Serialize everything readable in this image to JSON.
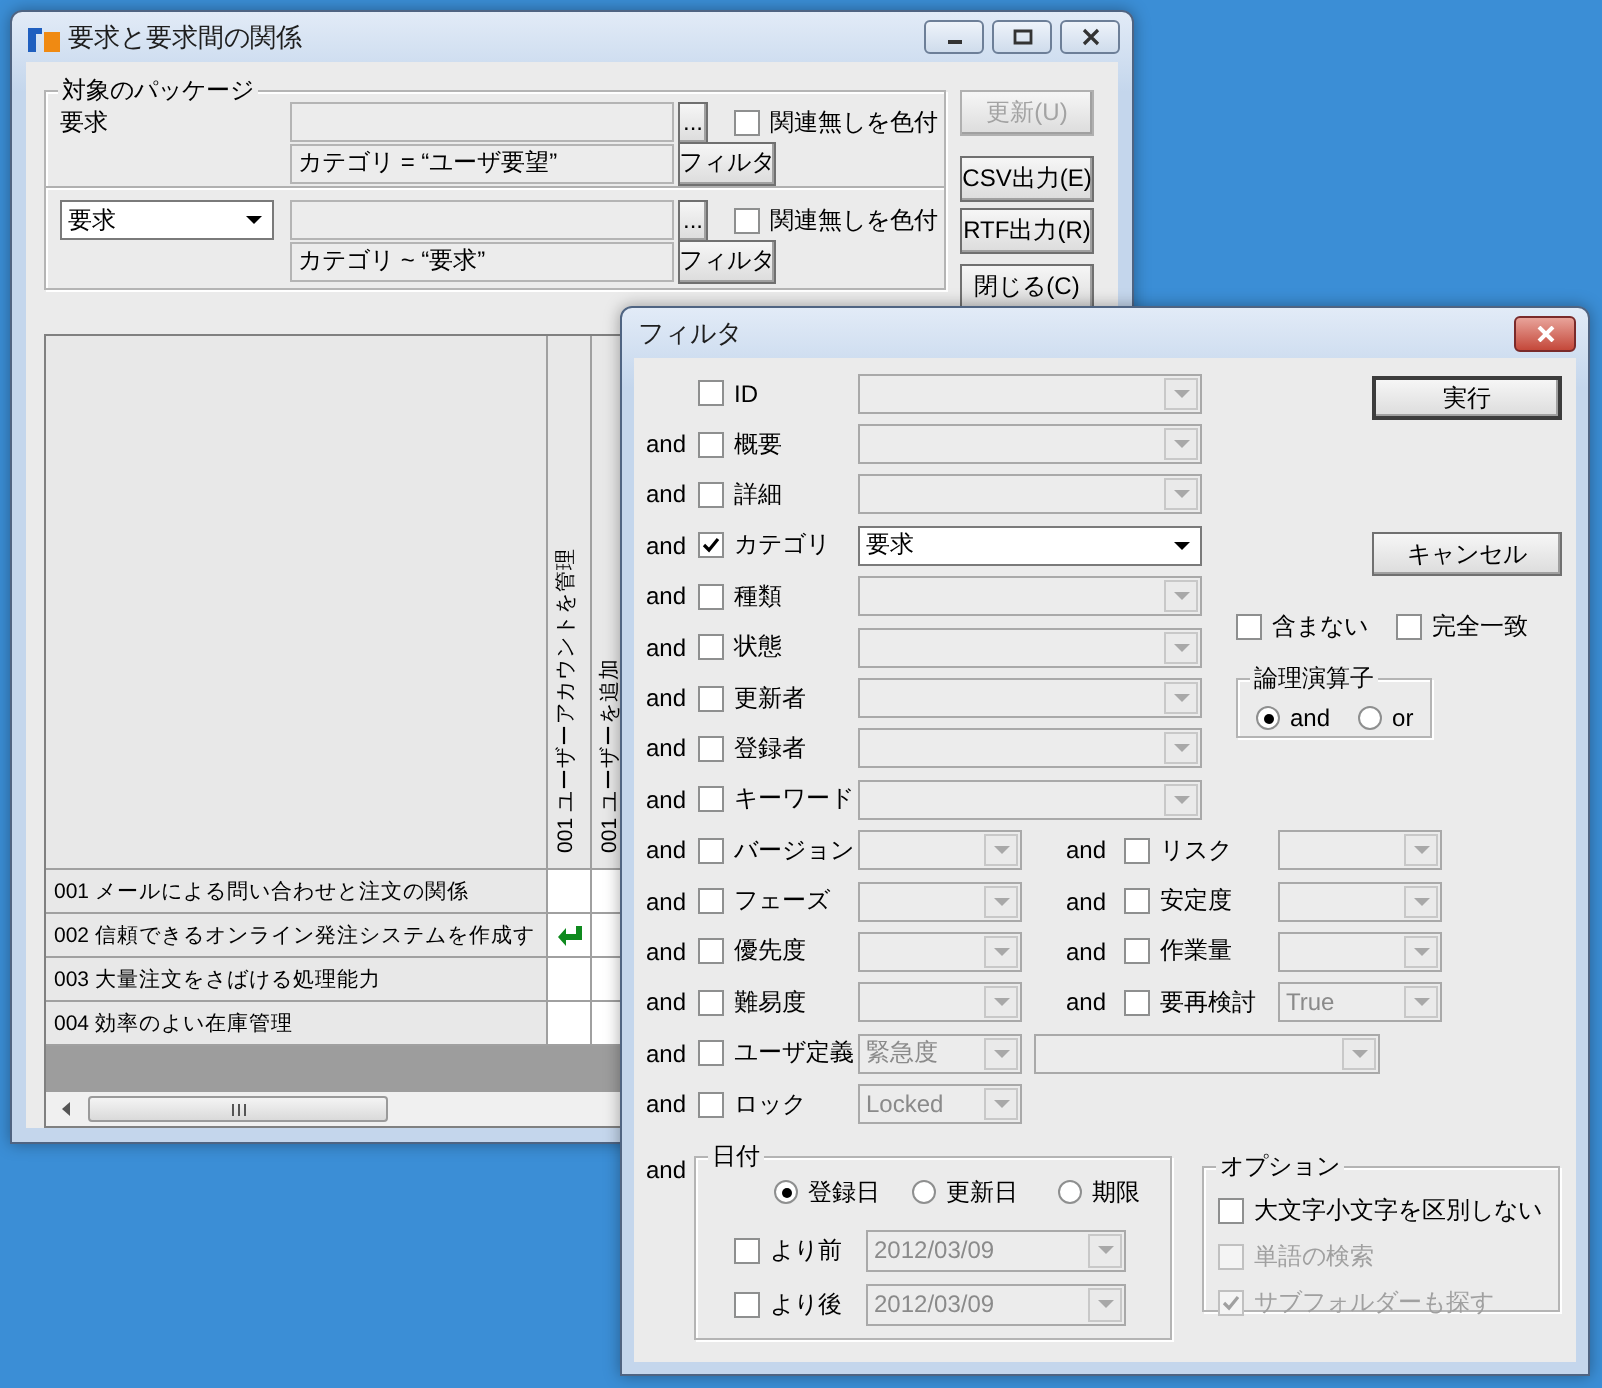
{
  "main_window": {
    "title": "要求と要求間の関係",
    "package_group": {
      "label": "対象のパッケージ",
      "rows": [
        {
          "kind": "label",
          "label": "要求",
          "browse_button": "...",
          "highlight_unlinked": {
            "label": "関連無しを色付",
            "checked": false
          },
          "filter_text": "カテゴリ = “ユーザ要望”",
          "filter_button": "フィルタ"
        },
        {
          "kind": "dropdown",
          "value": "要求",
          "browse_button": "...",
          "highlight_unlinked": {
            "label": "関連無しを色付",
            "checked": false
          },
          "filter_text": "カテゴリ ~ “要求”",
          "filter_button": "フィルタ"
        }
      ]
    },
    "buttons": [
      {
        "label": "更新(U)",
        "disabled": true
      },
      {
        "label": "CSV出力(E)",
        "disabled": false
      },
      {
        "label": "RTF出力(R)",
        "disabled": false
      },
      {
        "label": "閉じる(C)",
        "disabled": false
      }
    ],
    "matrix": {
      "columns": [
        "001 ユーザーアカウントを管理",
        "001 ユーザーを追加"
      ],
      "rows": [
        {
          "label": "001 メールによる問い合わせと注文の関係",
          "links": [
            false,
            false
          ]
        },
        {
          "label": "002 信頼できるオンライン発注システムを作成す",
          "links": [
            true,
            false
          ]
        },
        {
          "label": "003 大量注文をさばける処理能力",
          "links": [
            false,
            false
          ]
        },
        {
          "label": "004 効率のよい在庫管理",
          "links": [
            false,
            false
          ]
        }
      ]
    }
  },
  "filter_dialog": {
    "title": "フィルタ",
    "fields": [
      {
        "label": "ID",
        "checked": false
      },
      {
        "conjunction": "and",
        "label": "概要",
        "checked": false
      },
      {
        "conjunction": "and",
        "label": "詳細",
        "checked": false
      },
      {
        "conjunction": "and",
        "label": "カテゴリ",
        "checked": true,
        "value": "要求"
      },
      {
        "conjunction": "and",
        "label": "種類",
        "checked": false
      },
      {
        "conjunction": "and",
        "label": "状態",
        "checked": false
      },
      {
        "conjunction": "and",
        "label": "更新者",
        "checked": false
      },
      {
        "conjunction": "and",
        "label": "登録者",
        "checked": false
      },
      {
        "conjunction": "and",
        "label": "キーワード",
        "checked": false
      }
    ],
    "actions": [
      {
        "label": "実行",
        "default": true
      },
      {
        "label": "キャンセル",
        "default": false
      }
    ],
    "exclude": {
      "label": "含まない",
      "checked": false
    },
    "exact_match": {
      "label": "完全一致",
      "checked": false
    },
    "operator": {
      "label": "論理演算子",
      "options": [
        {
          "label": "and",
          "selected": true
        },
        {
          "label": "or",
          "selected": false
        }
      ]
    },
    "paired_fields": [
      {
        "left": {
          "conjunction": "and",
          "label": "バージョン",
          "checked": false
        },
        "right": {
          "conjunction": "and",
          "label": "リスク",
          "checked": false
        }
      },
      {
        "left": {
          "conjunction": "and",
          "label": "フェーズ",
          "checked": false
        },
        "right": {
          "conjunction": "and",
          "label": "安定度",
          "checked": false
        }
      },
      {
        "left": {
          "conjunction": "and",
          "label": "優先度",
          "checked": false
        },
        "right": {
          "conjunction": "and",
          "label": "作業量",
          "checked": false
        }
      },
      {
        "left": {
          "conjunction": "and",
          "label": "難易度",
          "checked": false
        },
        "right": {
          "conjunction": "and",
          "label": "要再検討",
          "checked": false,
          "value": "True"
        }
      }
    ],
    "user_defined": {
      "conjunction": "and",
      "label": "ユーザ定義",
      "checked": false,
      "attribute": "緊急度"
    },
    "lock": {
      "conjunction": "and",
      "label": "ロック",
      "checked": false,
      "value": "Locked"
    },
    "date": {
      "conjunction": "and",
      "label": "日付",
      "types": [
        {
          "label": "登録日",
          "selected": true
        },
        {
          "label": "更新日",
          "selected": false
        },
        {
          "label": "期限",
          "selected": false
        }
      ],
      "before": {
        "label": "より前",
        "checked": false,
        "value": "2012/03/09"
      },
      "after": {
        "label": "より後",
        "checked": false,
        "value": "2012/03/09"
      }
    },
    "options": {
      "label": "オプション",
      "items": [
        {
          "label": "大文字小文字を区別しない",
          "checked": false,
          "disabled": false
        },
        {
          "label": "単語の検索",
          "checked": false,
          "disabled": true
        },
        {
          "label": "サブフォルダーも探す",
          "checked": true,
          "disabled": true
        }
      ]
    }
  }
}
